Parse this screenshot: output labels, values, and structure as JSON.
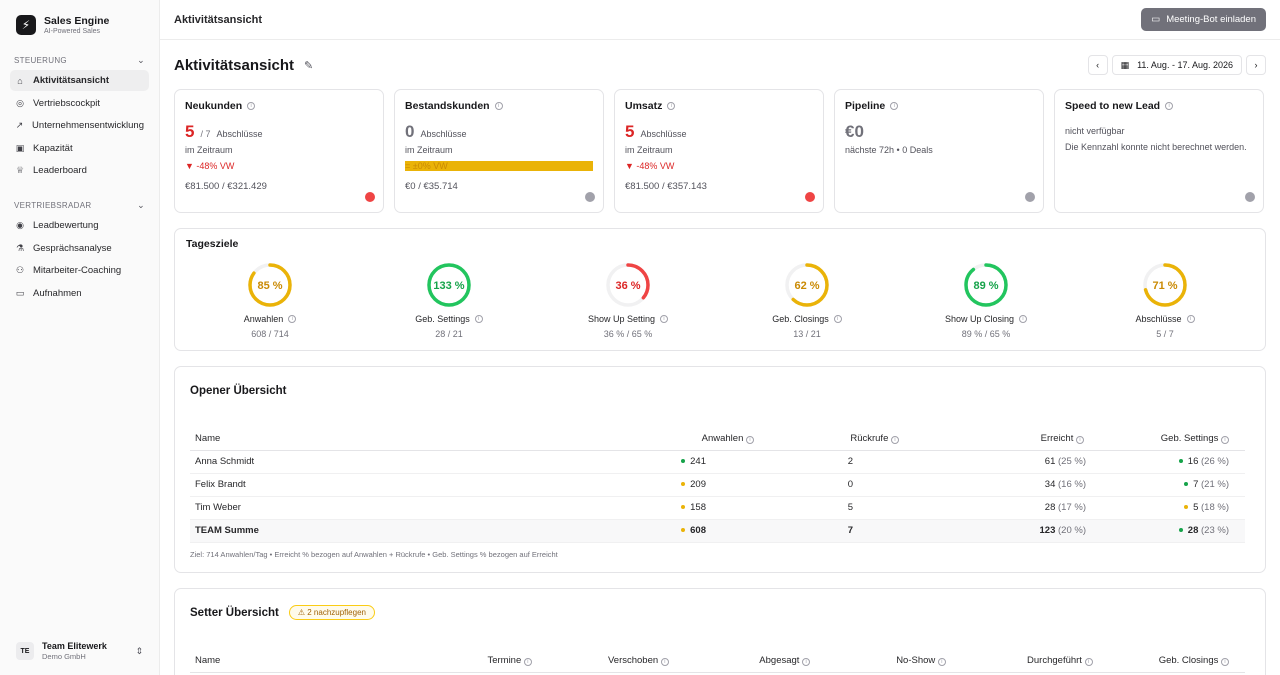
{
  "brand": {
    "name": "Sales Engine",
    "tagline": "AI-Powered Sales"
  },
  "sidebar": {
    "sections": [
      {
        "title": "STEUERUNG",
        "items": [
          {
            "label": "Aktivitätsansicht",
            "icon": "activity-icon",
            "active": true
          },
          {
            "label": "Vertriebscockpit",
            "icon": "gauge-icon"
          },
          {
            "label": "Unternehmensentwicklung",
            "icon": "trending-up-icon"
          },
          {
            "label": "Kapazität",
            "icon": "briefcase-icon"
          },
          {
            "label": "Leaderboard",
            "icon": "trophy-icon"
          }
        ]
      },
      {
        "title": "VERTRIEBSRADAR",
        "items": [
          {
            "label": "Leadbewertung",
            "icon": "target-icon"
          },
          {
            "label": "Gesprächsanalyse",
            "icon": "flask-icon"
          },
          {
            "label": "Mitarbeiter-Coaching",
            "icon": "users-icon"
          },
          {
            "label": "Aufnahmen",
            "icon": "video-icon"
          }
        ]
      }
    ],
    "workspace": {
      "initials": "TE",
      "name": "Team Elitewerk",
      "company": "Demo GmbH"
    }
  },
  "topbar": {
    "title": "Aktivitätsansicht",
    "meeting_button": "Meeting-Bot einladen"
  },
  "page": {
    "title": "Aktivitätsansicht",
    "date_range": "11. Aug. - 17. Aug. 2026"
  },
  "kpis": [
    {
      "title": "Neukunden",
      "value": "5",
      "of": "/ 7",
      "unit": "Abschlüsse",
      "line": "im Zeitraum",
      "delta": "▼ -48% VW",
      "money": "€81.500 / €321.429",
      "color": "#ef4444"
    },
    {
      "title": "Bestandskunden",
      "value": "0",
      "of": "",
      "unit": "Abschlüsse",
      "line": "im Zeitraum",
      "delta": "= ±0% VW",
      "money": "€0 / €35.714",
      "color": "#a1a1aa"
    },
    {
      "title": "Umsatz",
      "value": "5",
      "of": "",
      "unit": "Abschlüsse",
      "line": "im Zeitraum",
      "delta": "▼ -48% VW",
      "money": "€81.500 / €357.143",
      "color": "#ef4444"
    },
    {
      "title": "Pipeline",
      "value": "€0",
      "of": "",
      "unit": "",
      "line": "nächste 72h • 0 Deals",
      "delta": "",
      "money": "",
      "color": "#a1a1aa"
    },
    {
      "title": "Speed to new Lead",
      "value": "",
      "of": "",
      "unit": "",
      "line": "nicht verfügbar",
      "line2": "Die Kennzahl konnte nicht berechnet werden.",
      "delta": "",
      "money": "",
      "color": "#a1a1aa"
    }
  ],
  "goals": {
    "title": "Tagesziele",
    "items": [
      {
        "pct_label": "85 %",
        "pct": 85,
        "label": "Anwahlen",
        "sub": "608 / 714",
        "color": "#eab308",
        "text": "#ca8a04"
      },
      {
        "pct_label": "133 %",
        "pct": 100,
        "label": "Geb. Settings",
        "sub": "28 / 21",
        "color": "#22c55e",
        "text": "#16a34a"
      },
      {
        "pct_label": "36 %",
        "pct": 36,
        "label": "Show Up Setting",
        "sub": "36 % / 65 %",
        "color": "#ef4444",
        "text": "#dc2626"
      },
      {
        "pct_label": "62 %",
        "pct": 62,
        "label": "Geb. Closings",
        "sub": "13 / 21",
        "color": "#eab308",
        "text": "#ca8a04"
      },
      {
        "pct_label": "89 %",
        "pct": 89,
        "label": "Show Up Closing",
        "sub": "89 % / 65 %",
        "color": "#22c55e",
        "text": "#16a34a"
      },
      {
        "pct_label": "71 %",
        "pct": 71,
        "label": "Abschlüsse",
        "sub": "5 / 7",
        "color": "#eab308",
        "text": "#ca8a04"
      }
    ]
  },
  "opener": {
    "title": "Opener Übersicht",
    "columns": [
      "Name",
      "Anwahlen",
      "Rückrufe",
      "Erreicht",
      "Geb. Settings"
    ],
    "rows": [
      {
        "name": "Anna Schmidt",
        "anwahlen": "241",
        "a_dot": "green",
        "rueckrufe": "2",
        "erreicht": "61",
        "erreicht_pct": "(25 %)",
        "settings": "16",
        "settings_pct": "(26 %)",
        "s_dot": "green"
      },
      {
        "name": "Felix Brandt",
        "anwahlen": "209",
        "a_dot": "amber",
        "rueckrufe": "0",
        "erreicht": "34",
        "erreicht_pct": "(16 %)",
        "settings": "7",
        "settings_pct": "(21 %)",
        "s_dot": "green"
      },
      {
        "name": "Tim Weber",
        "anwahlen": "158",
        "a_dot": "amber",
        "rueckrufe": "5",
        "erreicht": "28",
        "erreicht_pct": "(17 %)",
        "settings": "5",
        "settings_pct": "(18 %)",
        "s_dot": "amber"
      }
    ],
    "total": {
      "name": "TEAM Summe",
      "anwahlen": "608",
      "a_dot": "amber",
      "rueckrufe": "7",
      "erreicht": "123",
      "erreicht_pct": "(20 %)",
      "settings": "28",
      "settings_pct": "(23 %)",
      "s_dot": "green"
    },
    "note": "Ziel: 714 Anwahlen/Tag • Erreicht % bezogen auf Anwahlen + Rückrufe • Geb. Settings % bezogen auf Erreicht"
  },
  "setter": {
    "title": "Setter Übersicht",
    "badge": "2 nachzupflegen",
    "columns": [
      "Name",
      "Termine",
      "Verschoben",
      "Abgesagt",
      "No-Show",
      "Durchgeführt",
      "Geb. Closings"
    ]
  }
}
